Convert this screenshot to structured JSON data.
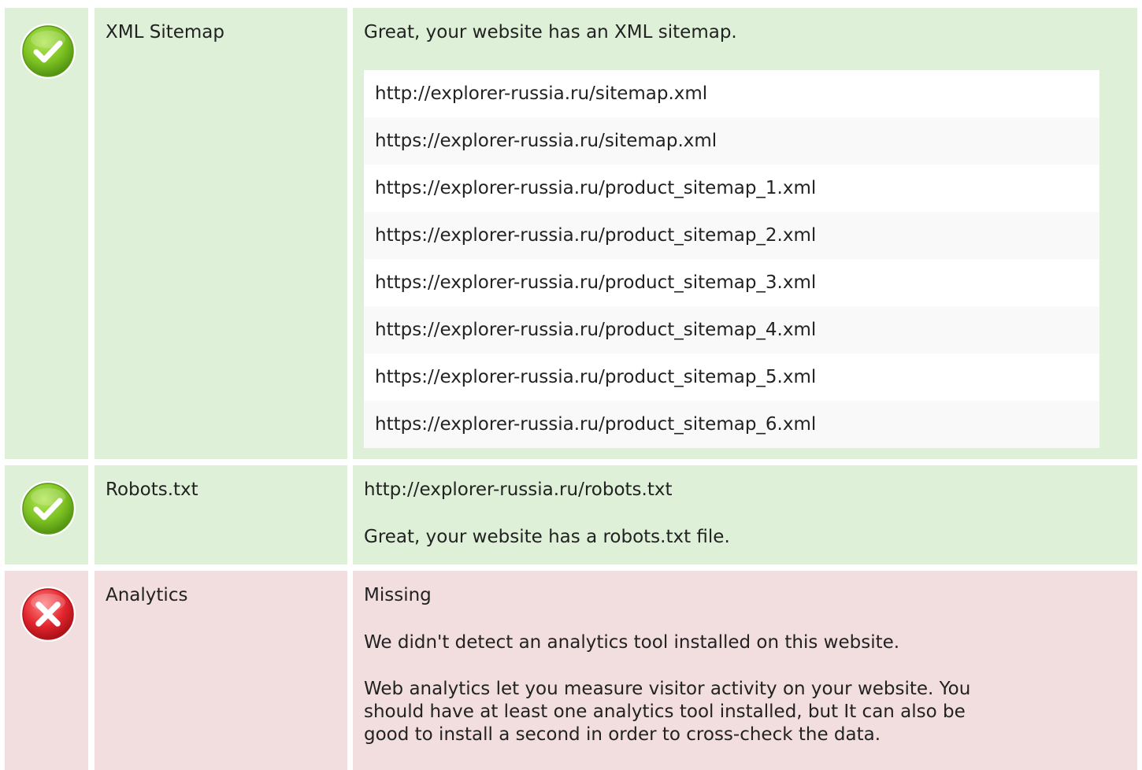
{
  "colors": {
    "pass_background": "#dff0d8",
    "fail_background": "#f2dede",
    "pass_icon": "#7cc122",
    "fail_icon": "#e2252d"
  },
  "checks": [
    {
      "status": "pass",
      "icon": "check-circle-icon",
      "label": "XML Sitemap",
      "message": "Great, your website has an XML sitemap.",
      "urls": [
        "http://explorer-russia.ru/sitemap.xml",
        "https://explorer-russia.ru/sitemap.xml",
        "https://explorer-russia.ru/product_sitemap_1.xml",
        "https://explorer-russia.ru/product_sitemap_2.xml",
        "https://explorer-russia.ru/product_sitemap_3.xml",
        "https://explorer-russia.ru/product_sitemap_4.xml",
        "https://explorer-russia.ru/product_sitemap_5.xml",
        "https://explorer-russia.ru/product_sitemap_6.xml"
      ]
    },
    {
      "status": "pass",
      "icon": "check-circle-icon",
      "label": "Robots.txt",
      "url": "http://explorer-russia.ru/robots.txt",
      "message": "Great, your website has a robots.txt file."
    },
    {
      "status": "fail",
      "icon": "cross-circle-icon",
      "label": "Analytics",
      "value": "Missing",
      "message": "We didn't detect an analytics tool installed on this website.",
      "description_lines": [
        "Web analytics let you measure visitor activity on your website. You",
        "should have at least one analytics tool installed, but It can also be",
        "good to install a second in order to cross-check the data."
      ]
    }
  ]
}
